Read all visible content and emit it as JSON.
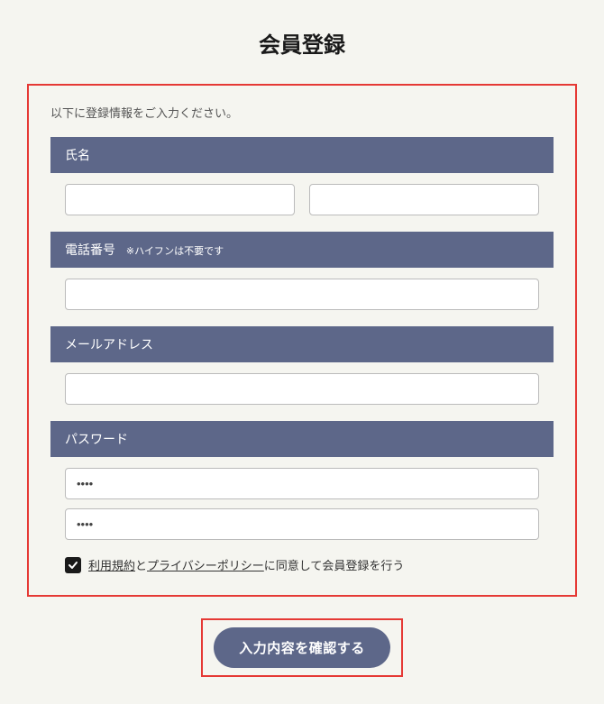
{
  "page": {
    "title": "会員登録",
    "instruction": "以下に登録情報をご入力ください。"
  },
  "sections": {
    "name": {
      "label": "氏名",
      "lastname_value": "",
      "firstname_value": ""
    },
    "phone": {
      "label": "電話番号",
      "hint": "※ハイフンは不要です",
      "value": ""
    },
    "email": {
      "label": "メールアドレス",
      "value": ""
    },
    "password": {
      "label": "パスワード",
      "value1": "••••",
      "value2": "••••"
    }
  },
  "consent": {
    "checked": true,
    "link1": "利用規約",
    "mid1": "と",
    "link2": "プライバシーポリシー",
    "suffix": "に同意して会員登録を行う"
  },
  "submit": {
    "label": "入力内容を確認する"
  }
}
